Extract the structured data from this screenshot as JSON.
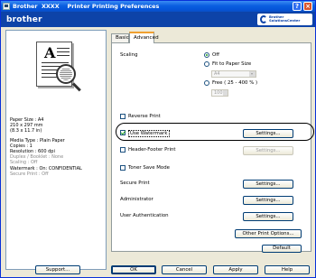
{
  "window": {
    "title": "Brother  XXXX    Printer Printing Preferences",
    "help_glyph": "?",
    "close_glyph": "×"
  },
  "brand": {
    "logo": "brother",
    "solutions": "Brother\nSolutionsCenter"
  },
  "preview": {
    "letter": "A"
  },
  "status": [
    {
      "text": "Paper Size : A4",
      "gray": false
    },
    {
      "text": "210 x 297 mm",
      "gray": false
    },
    {
      "text": "(8.3 x 11.7 in)",
      "gray": false
    },
    {
      "text": "",
      "gray": false
    },
    {
      "text": "Media Type : Plain Paper",
      "gray": false
    },
    {
      "text": "Copies : 1",
      "gray": false
    },
    {
      "text": "Resolution : 600 dpi",
      "gray": false
    },
    {
      "text": "Duplex / Booklet : None",
      "gray": true
    },
    {
      "text": "Scaling : Off",
      "gray": true
    },
    {
      "text": "Watermark : On: CONFIDENTIAL",
      "gray": false
    },
    {
      "text": "Secure Print : Off",
      "gray": true
    }
  ],
  "tabs": {
    "basic": "Basic",
    "advanced": "Advanced"
  },
  "scaling": {
    "label": "Scaling",
    "off": "Off",
    "fit": "Fit to Paper Size",
    "paper_value": "A4",
    "free": "Free ( 25 - 400 % )",
    "free_value": "100"
  },
  "options": {
    "reverse_print": "Reverse Print",
    "use_watermark": "Use Watermark",
    "header_footer": "Header-Footer Print",
    "toner_save": "Toner Save Mode",
    "secure_print": "Secure Print",
    "administrator": "Administrator",
    "user_auth": "User Authentication"
  },
  "buttons": {
    "settings": "Settings...",
    "other_print": "Other Print Options...",
    "default": "Default",
    "support": "Support...",
    "ok": "OK",
    "cancel": "Cancel",
    "apply": "Apply",
    "help": "Help"
  }
}
